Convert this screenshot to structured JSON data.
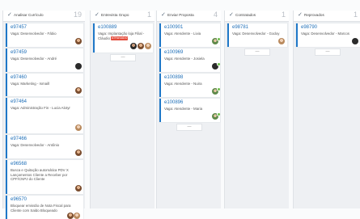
{
  "columns": [
    {
      "title": "Analisar Currículo",
      "count": "19",
      "cards": [
        {
          "id": "e97457",
          "desc": "Vaga: Desenvolvedor - Fábio"
        },
        {
          "id": "e97459",
          "desc": "Vaga: Desenvolvedor - André"
        },
        {
          "id": "e97460",
          "desc": "Vaga: Marketing - Ismaill"
        },
        {
          "id": "e97464",
          "desc": "Vaga: Administração Fin - Lucia Alotyr"
        },
        {
          "id": "e97466",
          "desc": "Vaga: Desenvolvedor - Antônio"
        },
        {
          "id": "e96568",
          "desc": "Busca e Quitação automática PDV X Lançamentos Cliente a Receber por CPF/CNPJ do Cliente"
        },
        {
          "id": "e96570",
          "desc": "Bloquear emissão de Nota Fiscal para Cliente com Saldo Bloqueado"
        }
      ]
    },
    {
      "title": "Entrevista Grupo",
      "count": "1",
      "cards": [
        {
          "id": "e100889",
          "desc": "Vaga: Implantação loja Filial - Cláudio",
          "badge": "ATRASADO"
        }
      ]
    },
    {
      "title": "Enviar Proposta",
      "count": "4",
      "cards": [
        {
          "id": "e100901",
          "desc": "Vaga: Atendente - Livia"
        },
        {
          "id": "e100969",
          "desc": "Vaga: Atendente - Josiela"
        },
        {
          "id": "e100898",
          "desc": "Vaga: Atendente - Nuira"
        },
        {
          "id": "e100896",
          "desc": "Vaga: Atendente - Maria"
        }
      ]
    },
    {
      "title": "Contratados",
      "count": "1",
      "cards": [
        {
          "id": "e98781",
          "desc": "Vaga: Desenvolvedor - Godoy"
        }
      ]
    },
    {
      "title": "Reprovados",
      "count": "1",
      "cards": [
        {
          "id": "e98790",
          "desc": "Vaga: Desenvolvedor - Marcos"
        }
      ]
    }
  ],
  "more_label": "—"
}
